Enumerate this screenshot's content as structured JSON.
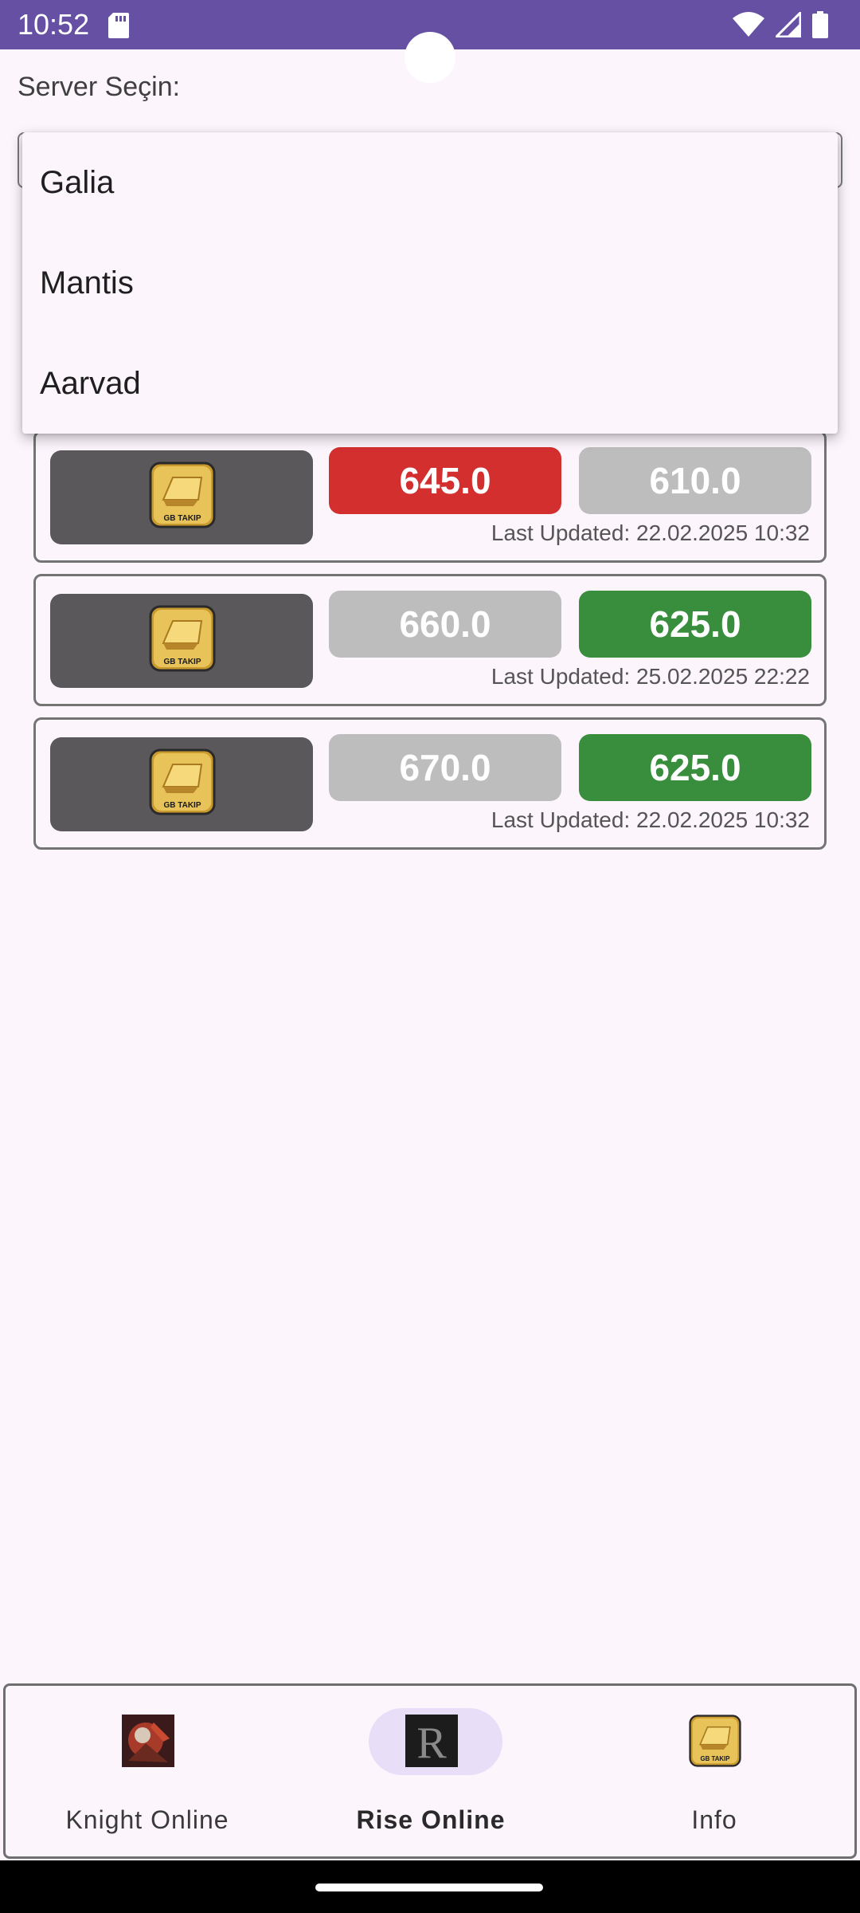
{
  "status_bar": {
    "time": "10:52"
  },
  "server": {
    "label": "Server Seçin:",
    "options": [
      "Galia",
      "Mantis",
      "Aarvad"
    ]
  },
  "cards": [
    {
      "price_1": "645.0",
      "price_1_color": "#d32f2f",
      "price_2": "610.0",
      "price_2_color": "#bdbdbd",
      "updated": "Last Updated: 22.02.2025 10:32"
    },
    {
      "price_1": "660.0",
      "price_1_color": "#bdbdbd",
      "price_2": "625.0",
      "price_2_color": "#388e3c",
      "updated": "Last Updated: 25.02.2025 22:22"
    },
    {
      "price_1": "670.0",
      "price_1_color": "#bdbdbd",
      "price_2": "625.0",
      "price_2_color": "#388e3c",
      "updated": "Last Updated: 22.02.2025 10:32"
    }
  ],
  "bottom_nav": [
    {
      "label": "Knight Online",
      "icon": "knight-online-icon",
      "active": false
    },
    {
      "label": "Rise Online",
      "icon": "rise-online-icon",
      "active": true
    },
    {
      "label": "Info",
      "icon": "gb-takip-icon",
      "active": false
    }
  ],
  "gb_icon_text": "GB TAKIP",
  "colors": {
    "status_bar": "#6650a4",
    "background": "#fcf5fc",
    "red": "#d32f2f",
    "green": "#388e3c",
    "grey": "#bdbdbd",
    "nav_active_pill": "#e8def8"
  }
}
